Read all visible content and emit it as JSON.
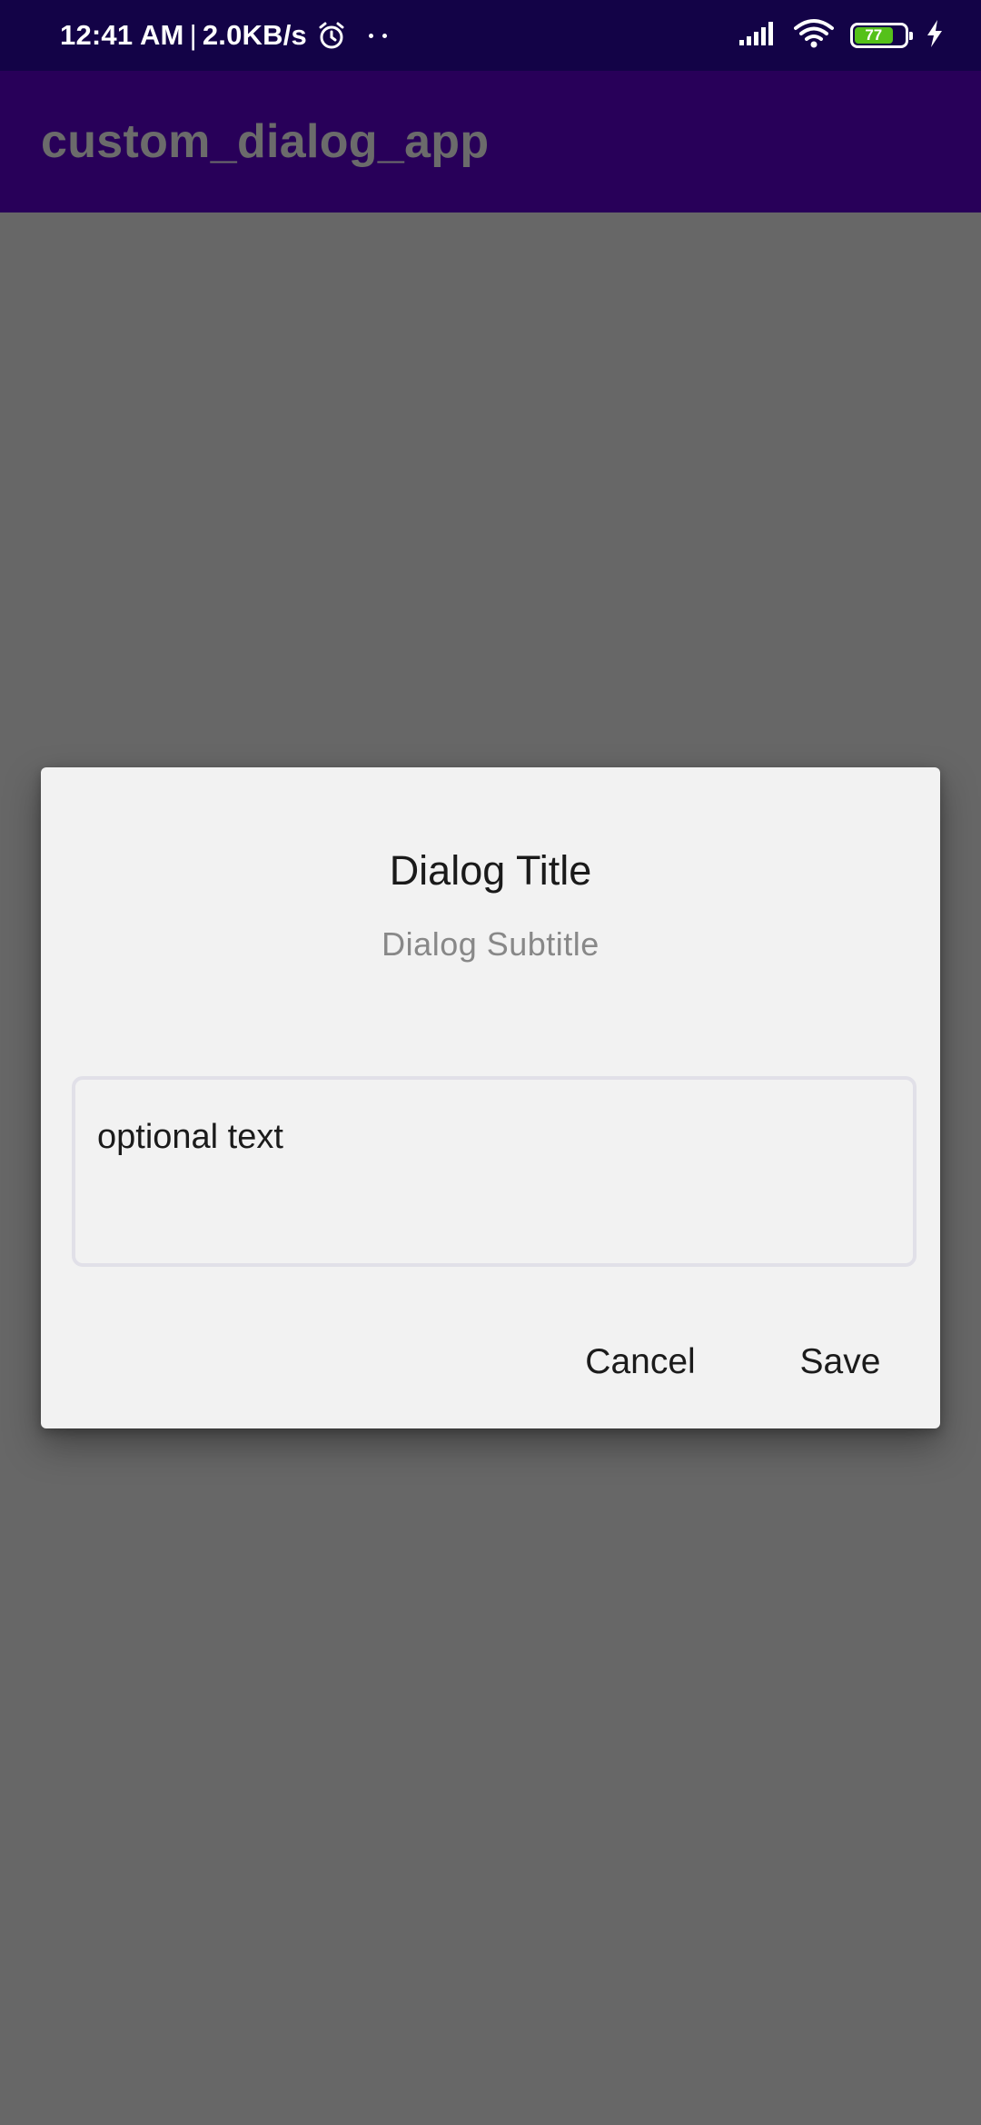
{
  "status_bar": {
    "time": "12:41 AM",
    "separator": "|",
    "speed": "2.0KB/s",
    "battery_level": "77",
    "battery_fraction": 0.77,
    "icons": [
      "alarm-icon",
      "notification-dots-icon",
      "signal-icon",
      "wifi-icon",
      "battery-icon",
      "charging-icon"
    ]
  },
  "app_bar": {
    "title": "custom_dialog_app"
  },
  "dialog": {
    "title": "Dialog Title",
    "subtitle": "Dialog Subtitle",
    "input_value": "optional text",
    "cancel_label": "Cancel",
    "save_label": "Save"
  },
  "colors": {
    "status_bar_bg": "#130347",
    "app_bar_bg": "#280059",
    "scrim": "#676767",
    "dialog_bg": "#f2f2f2",
    "battery_green": "#55c11a"
  }
}
